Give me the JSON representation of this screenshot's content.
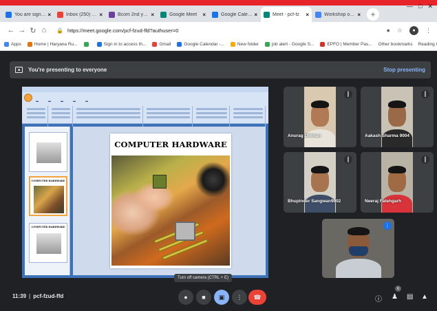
{
  "browser": {
    "tabs": [
      {
        "title": "You are signed in",
        "color": "#1a73e8",
        "active": false
      },
      {
        "title": "Inbox (250) - dr.s",
        "color": "#ea4335",
        "active": false
      },
      {
        "title": "Bcom 2nd year II",
        "color": "#6b3fa0",
        "active": false
      },
      {
        "title": "Google Meet",
        "color": "#00897b",
        "active": false
      },
      {
        "title": "Google Calendar",
        "color": "#1a73e8",
        "active": false
      },
      {
        "title": "Meet - pcf-fz",
        "color": "#00897b",
        "active": true
      },
      {
        "title": "Workshop on Con",
        "color": "#4285f4",
        "active": false
      }
    ],
    "url": "https://meet.google.com/pcf-fzud-ffd?authuser=0",
    "bookmarks": [
      {
        "label": "Apps",
        "color": "#4285f4"
      },
      {
        "label": "Home | Haryana Ru...",
        "color": "#e37400"
      },
      {
        "label": "",
        "color": "#34a853"
      },
      {
        "label": "Sign in to access th...",
        "color": "#1a73e8"
      },
      {
        "label": "Gmail",
        "color": "#ea4335"
      },
      {
        "label": "Google Calendar -...",
        "color": "#1a73e8"
      },
      {
        "label": "New folder",
        "color": "#f9ab00"
      },
      {
        "label": "job alert - Google S...",
        "color": "#34a853"
      },
      {
        "label": "EPFO | Member Pas...",
        "color": "#d93025"
      }
    ],
    "bookmarks_right": [
      "Other bookmarks",
      "Reading list"
    ]
  },
  "meet": {
    "banner_text": "You're presenting to everyone",
    "stop_label": "Stop presenting",
    "slide_title": "COMPUTER HARDWARE",
    "thumb_title": "COMPUTER HARDWARE",
    "participants": [
      {
        "name": "Anurag Dhiman",
        "skin": "#b07a55",
        "shirt": "#e8e4dc",
        "bg": "#d9c9b0"
      },
      {
        "name": "Aakash Sharma 9004",
        "skin": "#9a6a48",
        "shirt": "#2a2a2a",
        "bg": "#c9c3b6"
      },
      {
        "name": "Bhupinder Sangwan9002",
        "skin": "#a87450",
        "shirt": "#3e4e68",
        "bg": "#d4d0c6"
      },
      {
        "name": "Neeraj Fatehgarh",
        "skin": "#a06a44",
        "shirt": "#d8323a",
        "bg": "#b9b3a6"
      }
    ],
    "self": {
      "skin": "#8a5a3a",
      "shirt": "#c8cdd4",
      "bg": "#6a6862",
      "mask": "#1f3f6a"
    },
    "time": "11:39",
    "meeting_code": "pcf-fzud-ffd",
    "tooltip": "Turn off camera (CTRL + E)",
    "participant_count": "6"
  }
}
